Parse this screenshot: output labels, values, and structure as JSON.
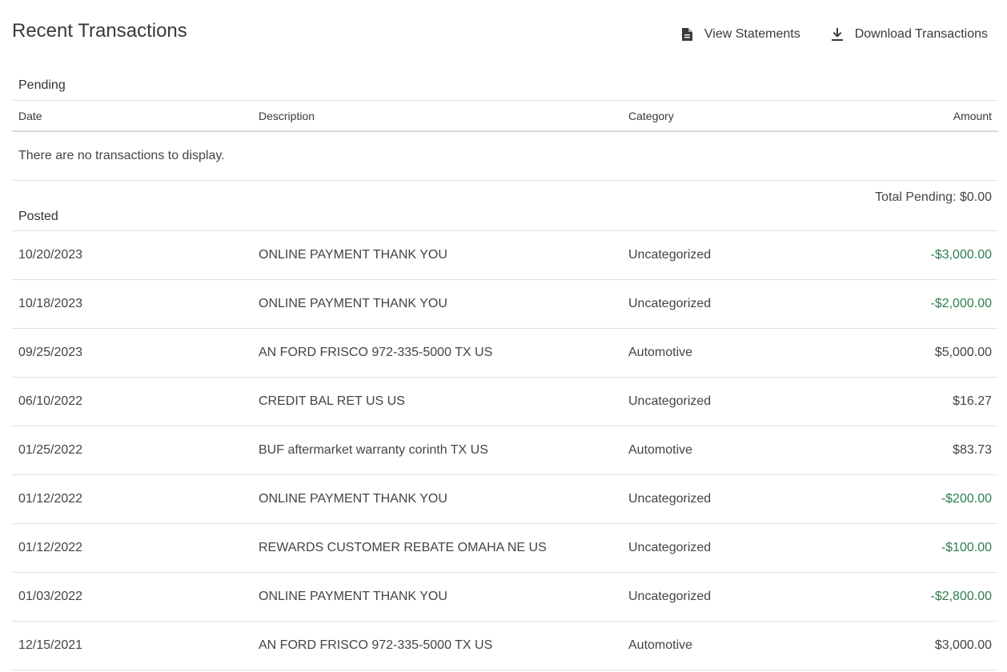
{
  "header": {
    "title": "Recent Transactions",
    "view_statements_label": "View Statements",
    "view_statements_icon": "document-icon",
    "download_label": "Download Transactions",
    "download_icon": "download-icon"
  },
  "columns": {
    "date": "Date",
    "description": "Description",
    "category": "Category",
    "amount": "Amount"
  },
  "pending": {
    "label": "Pending",
    "empty_message": "There are no transactions to display.",
    "total": "Total Pending: $0.00"
  },
  "posted": {
    "label": "Posted",
    "rows": [
      {
        "date": "10/20/2023",
        "description": "ONLINE PAYMENT THANK YOU",
        "category": "Uncategorized",
        "amount": "-$3,000.00",
        "credit": true
      },
      {
        "date": "10/18/2023",
        "description": "ONLINE PAYMENT THANK YOU",
        "category": "Uncategorized",
        "amount": "-$2,000.00",
        "credit": true
      },
      {
        "date": "09/25/2023",
        "description": "AN FORD FRISCO 972-335-5000 TX US",
        "category": "Automotive",
        "amount": "$5,000.00",
        "credit": false
      },
      {
        "date": "06/10/2022",
        "description": "CREDIT BAL RET US US",
        "category": "Uncategorized",
        "amount": "$16.27",
        "credit": false
      },
      {
        "date": "01/25/2022",
        "description": "BUF aftermarket warranty corinth TX US",
        "category": "Automotive",
        "amount": "$83.73",
        "credit": false
      },
      {
        "date": "01/12/2022",
        "description": "ONLINE PAYMENT THANK YOU",
        "category": "Uncategorized",
        "amount": "-$200.00",
        "credit": true
      },
      {
        "date": "01/12/2022",
        "description": "REWARDS CUSTOMER REBATE OMAHA NE US",
        "category": "Uncategorized",
        "amount": "-$100.00",
        "credit": true
      },
      {
        "date": "01/03/2022",
        "description": "ONLINE PAYMENT THANK YOU",
        "category": "Uncategorized",
        "amount": "-$2,800.00",
        "credit": true
      },
      {
        "date": "12/15/2021",
        "description": "AN FORD FRISCO 972-335-5000 TX US",
        "category": "Automotive",
        "amount": "$3,000.00",
        "credit": false
      }
    ]
  },
  "colors": {
    "credit": "#2e7d4f",
    "text": "#444444",
    "divider": "#e2e2e2"
  }
}
